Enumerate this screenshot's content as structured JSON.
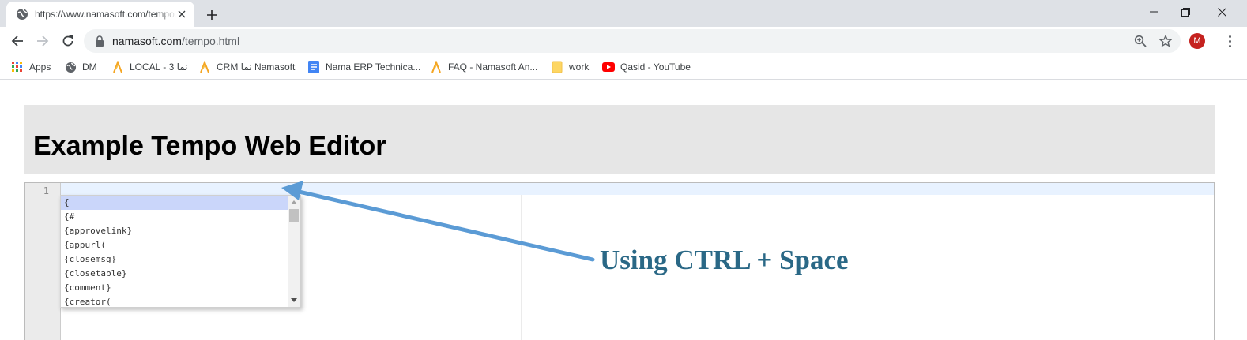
{
  "browser": {
    "tab": {
      "title": "https://www.namasoft.com/tempo.html",
      "favicon": "globe-icon"
    },
    "address_bar": {
      "domain": "namasoft.com",
      "path": "/tempo.html"
    },
    "avatar_letter": "M",
    "bookmarks": [
      {
        "label": "Apps",
        "icon": "apps-grid-icon"
      },
      {
        "label": "DM",
        "icon": "globe-icon"
      },
      {
        "label": "LOCAL - 3 نما",
        "icon": "nama-logo-icon"
      },
      {
        "label": "CRM نما Namasoft",
        "icon": "nama-logo-icon"
      },
      {
        "label": "Nama ERP Technica...",
        "icon": "docs-icon"
      },
      {
        "label": "FAQ - Namasoft An...",
        "icon": "nama-logo-icon"
      },
      {
        "label": "work",
        "icon": "folder-icon"
      },
      {
        "label": "Qasid - YouTube",
        "icon": "youtube-icon"
      }
    ]
  },
  "page": {
    "title": "Example Tempo Web Editor"
  },
  "editor": {
    "line_number": "1",
    "autocomplete_items": [
      "{",
      "{#",
      "{approvelink}",
      "{appurl(",
      "{closemsg}",
      "{closetable}",
      "{comment}",
      "{creator("
    ],
    "selected_index": 0
  },
  "annotation": {
    "text": "Using CTRL + Space",
    "color": "#2a6886",
    "arrow_color": "#5b9bd5"
  }
}
